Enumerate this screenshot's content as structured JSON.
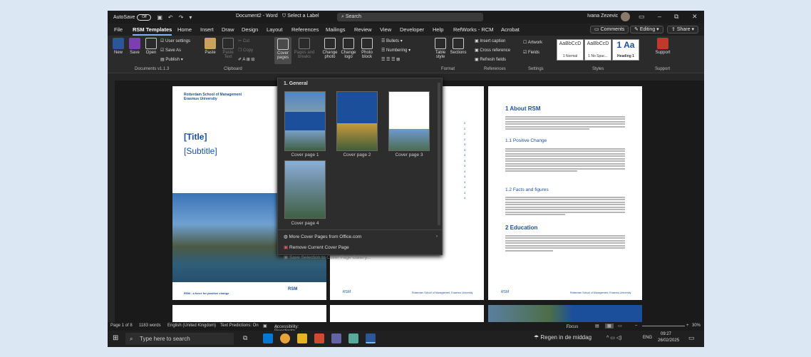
{
  "titlebar": {
    "autosave_label": "AutoSave",
    "autosave_state": "Off",
    "document_title": "Document2 - Word",
    "label_button": "Select a Label",
    "search_placeholder": "Search",
    "user_name": "Ivana Zezevic"
  },
  "menu": {
    "items": [
      "File",
      "RSM Templates",
      "Home",
      "Insert",
      "Draw",
      "Design",
      "Layout",
      "References",
      "Mailings",
      "Review",
      "View",
      "Developer",
      "Help",
      "RefWorks - RCM",
      "Acrobat"
    ],
    "comments": "Comments",
    "editing": "Editing",
    "share": "Share"
  },
  "ribbon": {
    "new": "New",
    "save": "Save",
    "open": "Open",
    "user_settings": "User settings",
    "save_as": "Save As",
    "publish": "Publish",
    "group_documents": "Documents v1.1.3",
    "paste": "Paste",
    "paste_text": "Paste Text",
    "cut": "Cut",
    "copy": "Copy",
    "group_clipboard": "Clipboard",
    "cover_pages": "Cover pages",
    "pages_and_breaks": "Pages and breaks",
    "change_photo": "Change photo",
    "change_logo": "Change logo",
    "photo_block": "Photo block",
    "bullets": "Bullets",
    "numbering": "Numbering",
    "table_style": "Table style",
    "sections": "Sections",
    "group_format": "Format",
    "insert_caption": "Insert caption",
    "cross_reference": "Cross reference",
    "refresh_fields": "Refresh fields",
    "group_references": "References",
    "artwork": "Artwork",
    "fields": "Fields",
    "group_settings": "Settings",
    "styles": [
      {
        "preview": "AaBbCcD",
        "name": "1 Normal"
      },
      {
        "preview": "AaBbCcD",
        "name": "1 No Spac..."
      },
      {
        "preview": "1 Aa",
        "name": "Heading 1"
      }
    ],
    "group_styles": "Styles",
    "support": "Support",
    "group_support": "Support"
  },
  "dropdown": {
    "header": "1. General",
    "covers": [
      "Cover page 1",
      "Cover page 2",
      "Cover page 3",
      "Cover page 4"
    ],
    "more": "More Cover Pages from Office.com",
    "remove": "Remove Current Cover Page",
    "save_selection": "Save Selection to Cover Page Gallery..."
  },
  "page1": {
    "org_line1": "Rotterdam School of Management",
    "org_line2": "Erasmus University",
    "title": "[Title]",
    "subtitle": "[Subtitle]",
    "footer_left": "RSM - a force for positive change",
    "footer_logo": "RSM"
  },
  "page3": {
    "h1_about": "1   About RSM",
    "h2_positive": "1.1   Positive Change",
    "h2_facts": "1.2   Facts and figures",
    "h1_education": "2   Education",
    "footer": "Rotterdam School of Management, Erasmus University"
  },
  "statusbar": {
    "page": "Page 1 of 8",
    "words": "1183 words",
    "language": "English (United Kingdom)",
    "predictions": "Text Predictions: On",
    "accessibility": "Accessibility: Investigate",
    "focus": "Focus",
    "zoom": "30%"
  },
  "taskbar": {
    "search_placeholder": "Type here to search",
    "weather": "Regen in de middag",
    "lang": "ENG",
    "time": "09:27",
    "date": "26/02/2025"
  },
  "colors": {
    "accent": "#7fb2ff",
    "rsm_blue": "#1b4f9c",
    "word_blue": "#2b579a"
  }
}
